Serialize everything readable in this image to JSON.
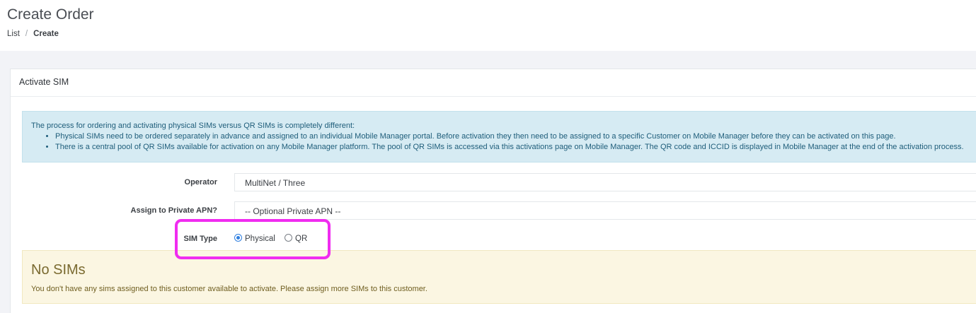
{
  "header": {
    "title": "Create Order",
    "breadcrumb": {
      "list": "List",
      "separator": "/",
      "current": "Create"
    }
  },
  "card": {
    "title": "Activate SIM"
  },
  "info_alert": {
    "intro": "The process for ordering and activating physical SIMs versus QR SIMs is completely different:",
    "bullets": [
      "Physical SIMs need to be ordered separately in advance and assigned to an individual Mobile Manager portal. Before activation they then need to be assigned to a specific Customer on Mobile Manager before they can be activated on this page.",
      "There is a central pool of QR SIMs available for activation on any Mobile Manager platform. The pool of QR SIMs is accessed via this activations page on Mobile Manager. The QR code and ICCID is displayed in Mobile Manager at the end of the activation process."
    ]
  },
  "form": {
    "operator": {
      "label": "Operator",
      "value": "MultiNet / Three"
    },
    "private_apn": {
      "label": "Assign to Private APN?",
      "value": "-- Optional Private APN --"
    },
    "sim_type": {
      "label": "SIM Type",
      "options": [
        {
          "label": "Physical",
          "checked": true
        },
        {
          "label": "QR",
          "checked": false
        }
      ]
    }
  },
  "warning_alert": {
    "heading": "No SIMs",
    "message": "You don't have any sims assigned to this customer available to activate. Please assign more SIMs to this customer."
  },
  "colors": {
    "highlight": "#f02cf0",
    "info_bg": "#d6ebf3",
    "warning_bg": "#fbf6e2",
    "radio_accent": "#2f7fe0"
  }
}
